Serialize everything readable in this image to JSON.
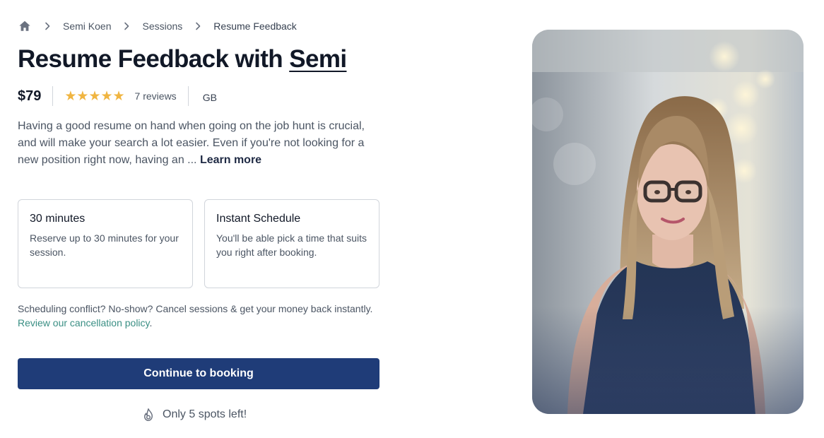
{
  "breadcrumb": {
    "home_icon": "home-icon",
    "items": [
      "Semi Koen",
      "Sessions",
      "Resume Feedback"
    ]
  },
  "title": {
    "prefix": "Resume Feedback with ",
    "host": "Semi"
  },
  "meta": {
    "price": "$79",
    "stars": "★★★★★",
    "rating": 5,
    "reviews": "7 reviews",
    "language": "GB"
  },
  "description": {
    "text": "Having a good resume on hand when going on the job hunt is crucial, and will make your search a lot easier. Even if you're not looking for a new position right now, having an ... ",
    "more": "Learn more"
  },
  "cards": [
    {
      "title": "30 minutes",
      "text": "Reserve up to 30 minutes for your session."
    },
    {
      "title": "Instant Schedule",
      "text": "You'll be able pick a time that suits you right after booking."
    }
  ],
  "policy": {
    "text": "Scheduling conflict? No-show? Cancel sessions & get your money back instantly. ",
    "link": "Review our cancellation policy",
    "suffix": "."
  },
  "cta": {
    "label": "Continue to booking"
  },
  "availability": {
    "icon": "flame-icon",
    "text": "Only 5 spots left!"
  },
  "colors": {
    "primary": "#1f3c78",
    "star": "#f0b541",
    "link": "#3a8f84"
  }
}
